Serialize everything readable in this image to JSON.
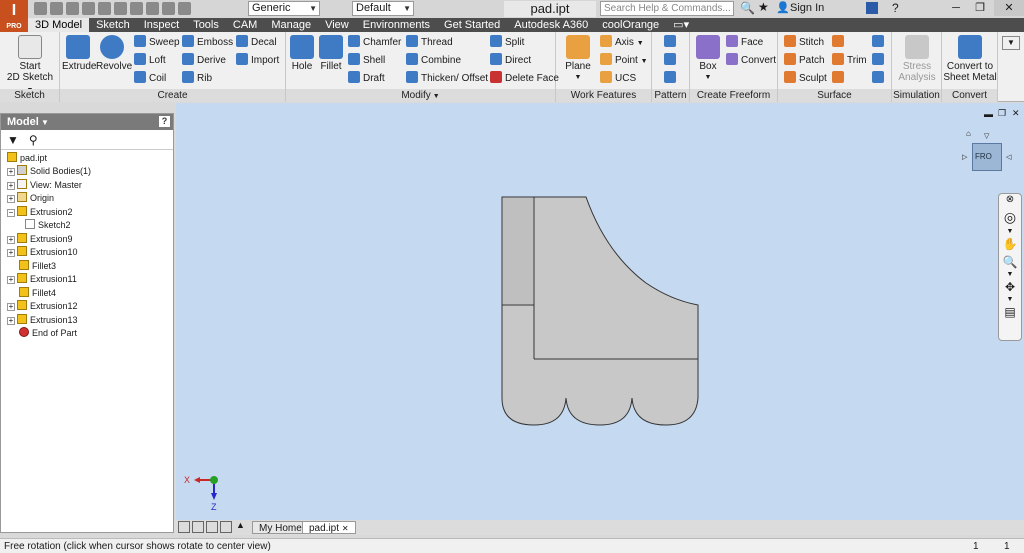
{
  "title_bar": {
    "app_badge": "I",
    "app_edition": "PRO",
    "appearance_combo": "Generic",
    "material_combo": "Default",
    "file_title": "pad.ipt",
    "search_placeholder": "Search Help & Commands...",
    "sign_in": "Sign In"
  },
  "ribbon_tabs": [
    "3D Model",
    "Sketch",
    "Inspect",
    "Tools",
    "CAM",
    "Manage",
    "View",
    "Environments",
    "Get Started",
    "Autodesk A360",
    "coolOrange"
  ],
  "active_tab": "3D Model",
  "ribbon": {
    "sketch": {
      "label": "Sketch",
      "start_line1": "Start",
      "start_line2": "2D Sketch"
    },
    "create": {
      "label": "Create",
      "extrude": "Extrude",
      "revolve": "Revolve",
      "sweep": "Sweep",
      "loft": "Loft",
      "coil": "Coil",
      "emboss": "Emboss",
      "derive": "Derive",
      "rib": "Rib",
      "decal": "Decal",
      "import": "Import"
    },
    "modify": {
      "label": "Modify",
      "hole": "Hole",
      "fillet": "Fillet",
      "chamfer": "Chamfer",
      "shell": "Shell",
      "draft": "Draft",
      "thread": "Thread",
      "combine": "Combine",
      "thicken": "Thicken/ Offset",
      "split": "Split",
      "direct": "Direct",
      "delete_face": "Delete Face"
    },
    "work_features": {
      "label": "Work Features",
      "plane": "Plane",
      "axis": "Axis",
      "point": "Point",
      "ucs": "UCS"
    },
    "pattern": {
      "label": "Pattern"
    },
    "freeform": {
      "label": "Create Freeform",
      "box": "Box",
      "face": "Face",
      "convert": "Convert"
    },
    "surface": {
      "label": "Surface",
      "stitch": "Stitch",
      "patch": "Patch",
      "sculpt": "Sculpt",
      "trim": "Trim"
    },
    "simulation": {
      "label": "Simulation",
      "stress_line1": "Stress",
      "stress_line2": "Analysis"
    },
    "convert": {
      "label": "Convert",
      "line1": "Convert to",
      "line2": "Sheet Metal"
    }
  },
  "browser": {
    "title": "Model",
    "help": "?",
    "items": [
      {
        "label": "pad.ipt",
        "level": 0,
        "expand": false
      },
      {
        "label": "Solid Bodies(1)",
        "level": 1,
        "expand": true
      },
      {
        "label": "View: Master",
        "level": 1,
        "expand": true
      },
      {
        "label": "Origin",
        "level": 1,
        "expand": true
      },
      {
        "label": "Extrusion2",
        "level": 1,
        "expand": true
      },
      {
        "label": "Sketch2",
        "level": 2,
        "expand": false
      },
      {
        "label": "Extrusion9",
        "level": 1,
        "expand": true
      },
      {
        "label": "Extrusion10",
        "level": 1,
        "expand": true
      },
      {
        "label": "Fillet3",
        "level": 1,
        "expand": false
      },
      {
        "label": "Extrusion11",
        "level": 1,
        "expand": true
      },
      {
        "label": "Fillet4",
        "level": 1,
        "expand": false
      },
      {
        "label": "Extrusion12",
        "level": 1,
        "expand": true
      },
      {
        "label": "Extrusion13",
        "level": 1,
        "expand": true
      },
      {
        "label": "End of Part",
        "level": 1,
        "expand": false
      }
    ]
  },
  "viewcube": {
    "face_label": "FRO"
  },
  "triad": {
    "x_label": "X",
    "z_label": "Z"
  },
  "doc_tabs": {
    "home": "My Home",
    "file": "pad.ipt"
  },
  "status": {
    "message": "Free rotation (click when cursor shows rotate to center view)",
    "count_a": "1",
    "count_b": "1"
  },
  "colors": {
    "viewport_bg": "#c5daf1",
    "part_fill": "#c8c8c8",
    "ribbon_tabbar": "#4d4d4d",
    "brand_orange": "#c8501e"
  }
}
